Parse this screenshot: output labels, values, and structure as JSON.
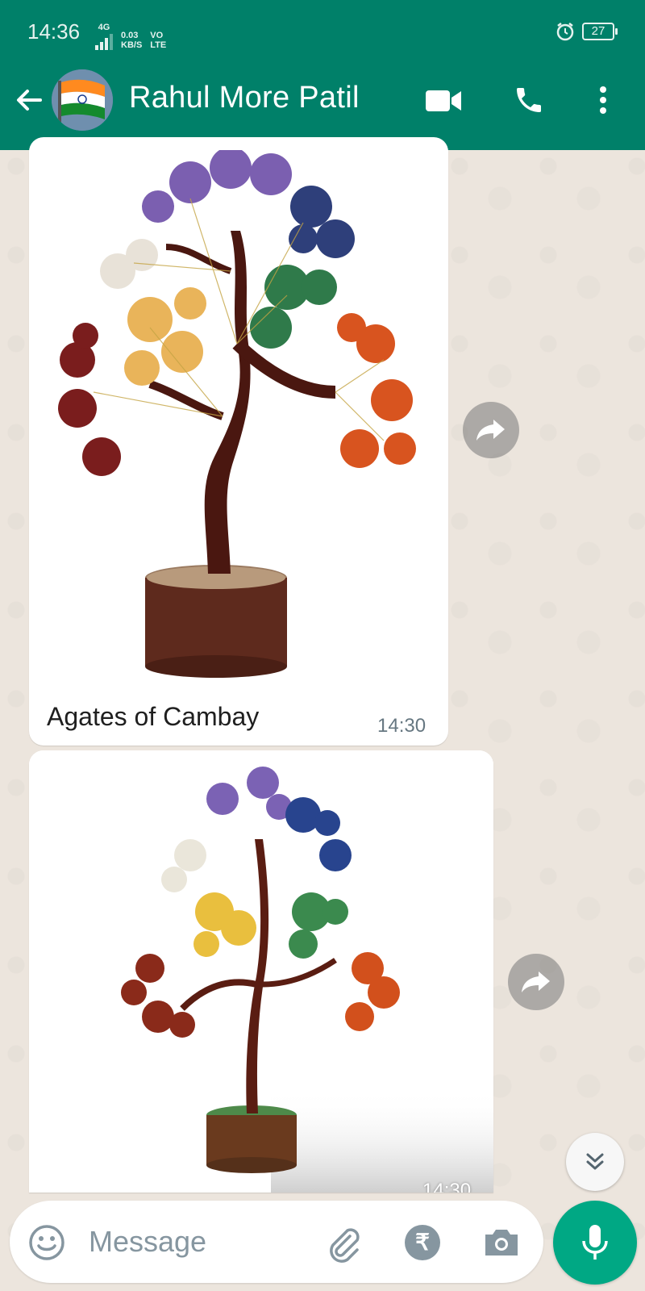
{
  "status_bar": {
    "time": "14:36",
    "network_top": "4G",
    "speed_value": "0.03",
    "speed_unit": "KB/S",
    "volte_top": "VO",
    "volte_bottom": "LTE",
    "battery": "27"
  },
  "header": {
    "contact_name": "Rahul More Patil",
    "avatar_icon": "india-flag-avatar",
    "background_color": "#008069"
  },
  "messages": [
    {
      "type": "image",
      "image_alt": "gemstone tree with wooden base",
      "caption": "Agates of Cambay",
      "time": "14:30"
    },
    {
      "type": "image",
      "image_alt": "gemstone tree with wooden base",
      "caption": "",
      "time": "14:30"
    }
  ],
  "input": {
    "placeholder": "Message"
  },
  "icons": {
    "back": "arrow-left-icon",
    "video": "video-call-icon",
    "call": "phone-icon",
    "menu": "more-vertical-icon",
    "forward": "forward-icon",
    "scroll": "double-chevron-down-icon",
    "emoji": "emoji-icon",
    "attach": "paperclip-icon",
    "payment": "rupee-icon",
    "camera": "camera-icon",
    "mic": "microphone-icon"
  },
  "colors": {
    "accent": "#00a884",
    "chat_background": "#ece5dd"
  }
}
